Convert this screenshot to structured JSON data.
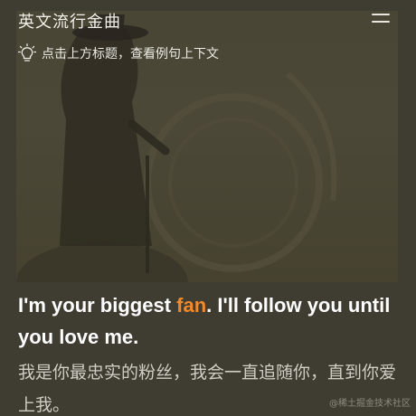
{
  "header": {
    "title": "英文流行金曲",
    "menu_icon": "hamburger-menu-icon"
  },
  "hint": {
    "icon": "lightbulb-icon",
    "text": "点击上方标题，查看例句上下文"
  },
  "sentence": {
    "en_before": "I'm your biggest ",
    "en_highlight": "fan",
    "en_after": ". I'll follow you until you love me.",
    "zh": "我是你最忠实的粉丝，我会一直追随你，直到你爱上我。",
    "highlight_color": "#f08a2c"
  },
  "watermark": "@稀土掘金技术社区"
}
